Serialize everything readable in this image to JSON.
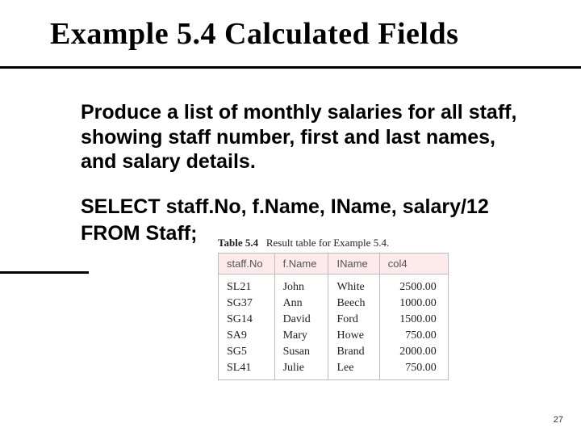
{
  "title": "Example 5.4  Calculated Fields",
  "prompt": "Produce a list of monthly salaries for all staff, showing staff number, first and last names, and  salary details.",
  "sql_line1": "SELECT staff.No, f.Name, IName, salary/12",
  "sql_line2": "FROM Staff;",
  "caption_bold": "Table 5.4",
  "caption_rest": "Result table for Example 5.4.",
  "chart_data": {
    "type": "table",
    "columns": [
      "staff.No",
      "f.Name",
      "IName",
      "col4"
    ],
    "rows": [
      [
        "SL21",
        "John",
        "White",
        "2500.00"
      ],
      [
        "SG37",
        "Ann",
        "Beech",
        "1000.00"
      ],
      [
        "SG14",
        "David",
        "Ford",
        "1500.00"
      ],
      [
        "SA9",
        "Mary",
        "Howe",
        "750.00"
      ],
      [
        "SG5",
        "Susan",
        "Brand",
        "2000.00"
      ],
      [
        "SL41",
        "Julie",
        "Lee",
        "750.00"
      ]
    ]
  },
  "page_number": "27"
}
